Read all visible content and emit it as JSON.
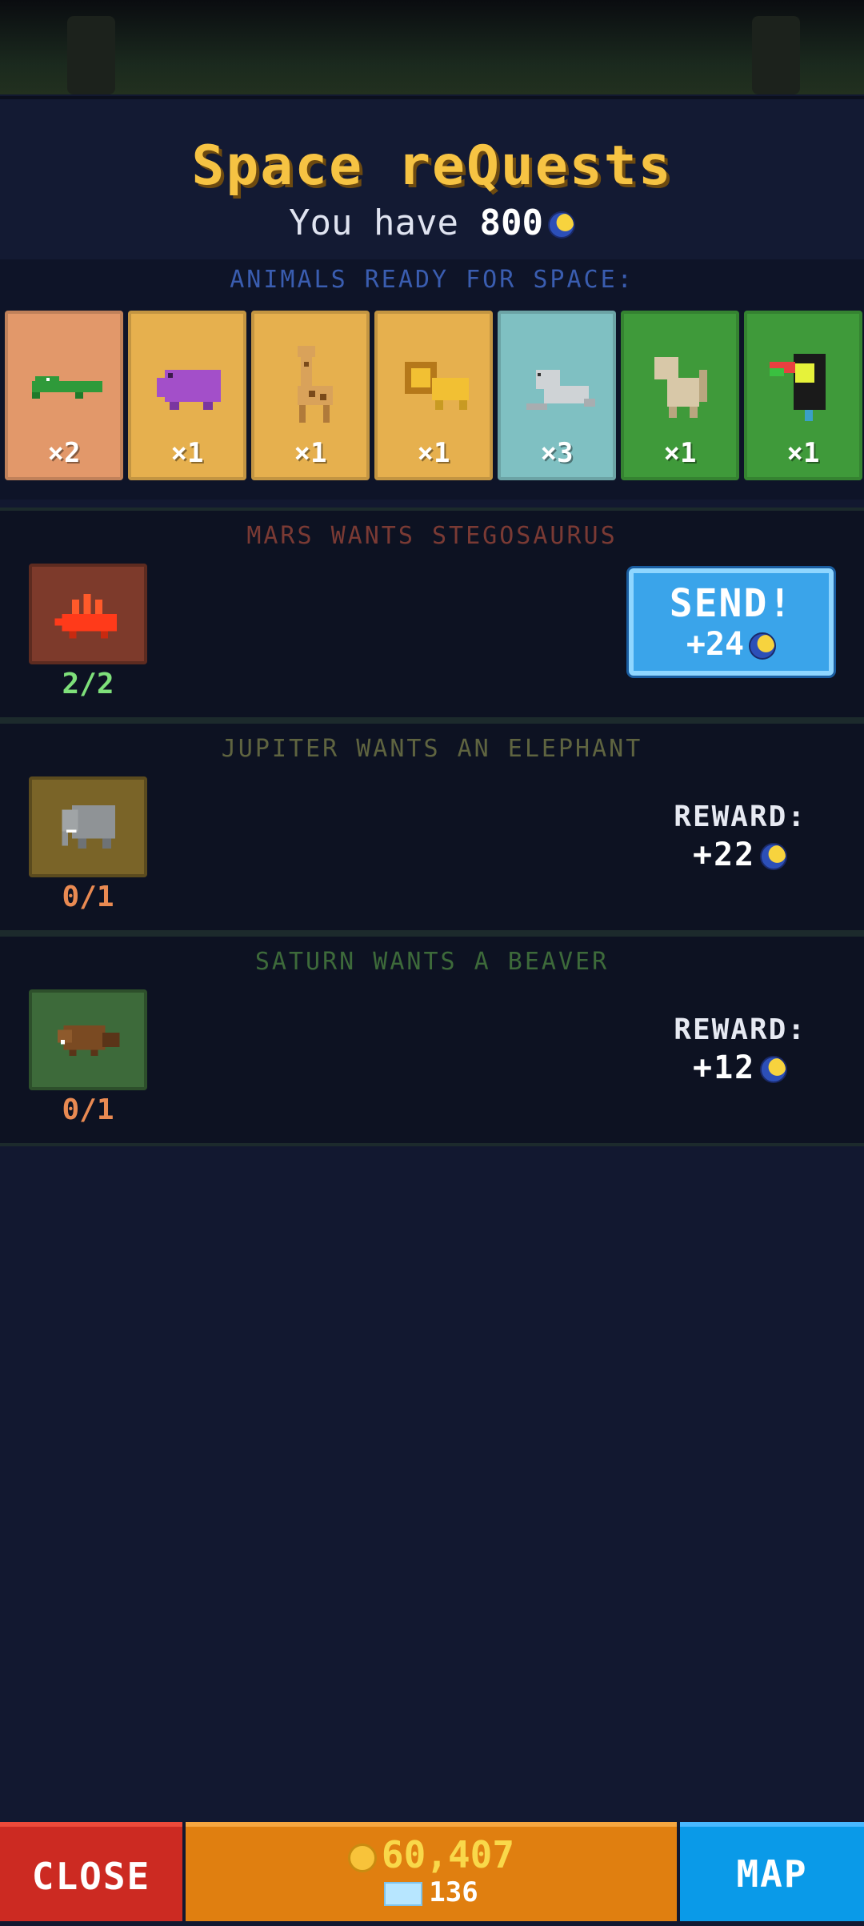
{
  "header": {
    "title": "Space reQuests",
    "balance_prefix": "You have",
    "balance_value": "800",
    "currency_icon": "moon-coin-icon"
  },
  "ready": {
    "label": "ANIMALS READY FOR SPACE:",
    "animals": [
      {
        "name": "crocodile",
        "count": "×2",
        "color": "#e2986a"
      },
      {
        "name": "hippo",
        "count": "×1",
        "color": "#e6b04e"
      },
      {
        "name": "giraffe",
        "count": "×1",
        "color": "#e6b04e"
      },
      {
        "name": "lion",
        "count": "×1",
        "color": "#e6b04e"
      },
      {
        "name": "seal",
        "count": "×3",
        "color": "#7fc0c2"
      },
      {
        "name": "monkey",
        "count": "×1",
        "color": "#3f9a3a"
      },
      {
        "name": "toucan",
        "count": "×1",
        "color": "#3f9a3a"
      }
    ]
  },
  "quests": [
    {
      "label": "MARS WANTS STEGOSAURUS",
      "label_color": "#7a3a34",
      "animal": "stegosaurus",
      "tile_color": "#7d3a2b",
      "progress": "2/2",
      "progress_color": "#7ee07a",
      "action": {
        "type": "send",
        "label": "SEND!",
        "value": "+24"
      }
    },
    {
      "label": "JUPITER WANTS AN ELEPHANT",
      "label_color": "#5f6440",
      "animal": "elephant",
      "tile_color": "#7a6428",
      "progress": "0/1",
      "progress_color": "#e98a52",
      "action": {
        "type": "reward",
        "label": "REWARD:",
        "value": "+22"
      }
    },
    {
      "label": "SATURN WANTS A BEAVER",
      "label_color": "#3d6a3a",
      "animal": "beaver",
      "tile_color": "#3d6a3a",
      "progress": "0/1",
      "progress_color": "#e98a52",
      "action": {
        "type": "reward",
        "label": "REWARD:",
        "value": "+12"
      }
    }
  ],
  "bottom": {
    "close_label": "CLOSE",
    "coins": "60,407",
    "gems": "136",
    "map_label": "MAP"
  }
}
